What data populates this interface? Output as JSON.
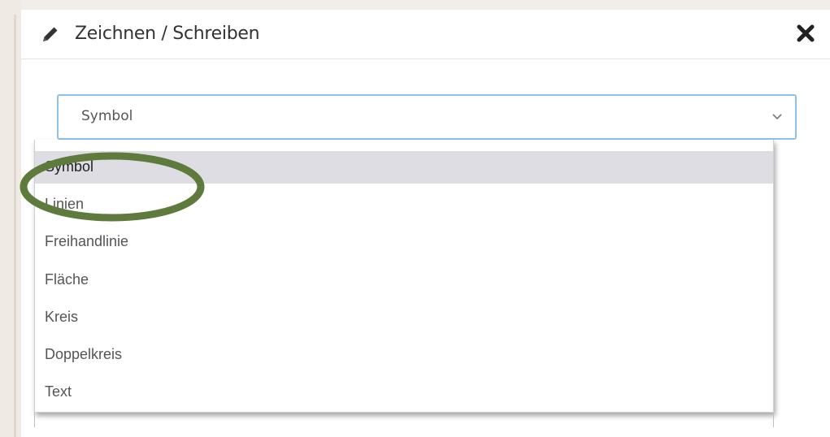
{
  "dialog": {
    "title": "Zeichnen / Schreiben",
    "header_icon": "pencil-icon",
    "close_icon": "close-icon"
  },
  "select": {
    "value": "Symbol",
    "expanded": true,
    "accent_color": "#8fc1e6",
    "options": [
      {
        "label": "Symbol",
        "selected": true
      },
      {
        "label": "Linien",
        "selected": false
      },
      {
        "label": "Freihandlinie",
        "selected": false
      },
      {
        "label": "Fläche",
        "selected": false
      },
      {
        "label": "Kreis",
        "selected": false
      },
      {
        "label": "Doppelkreis",
        "selected": false
      },
      {
        "label": "Text",
        "selected": false
      }
    ]
  },
  "annotation": {
    "type": "highlight-ellipse",
    "color": "#5e7a3c",
    "target": "Symbol"
  }
}
